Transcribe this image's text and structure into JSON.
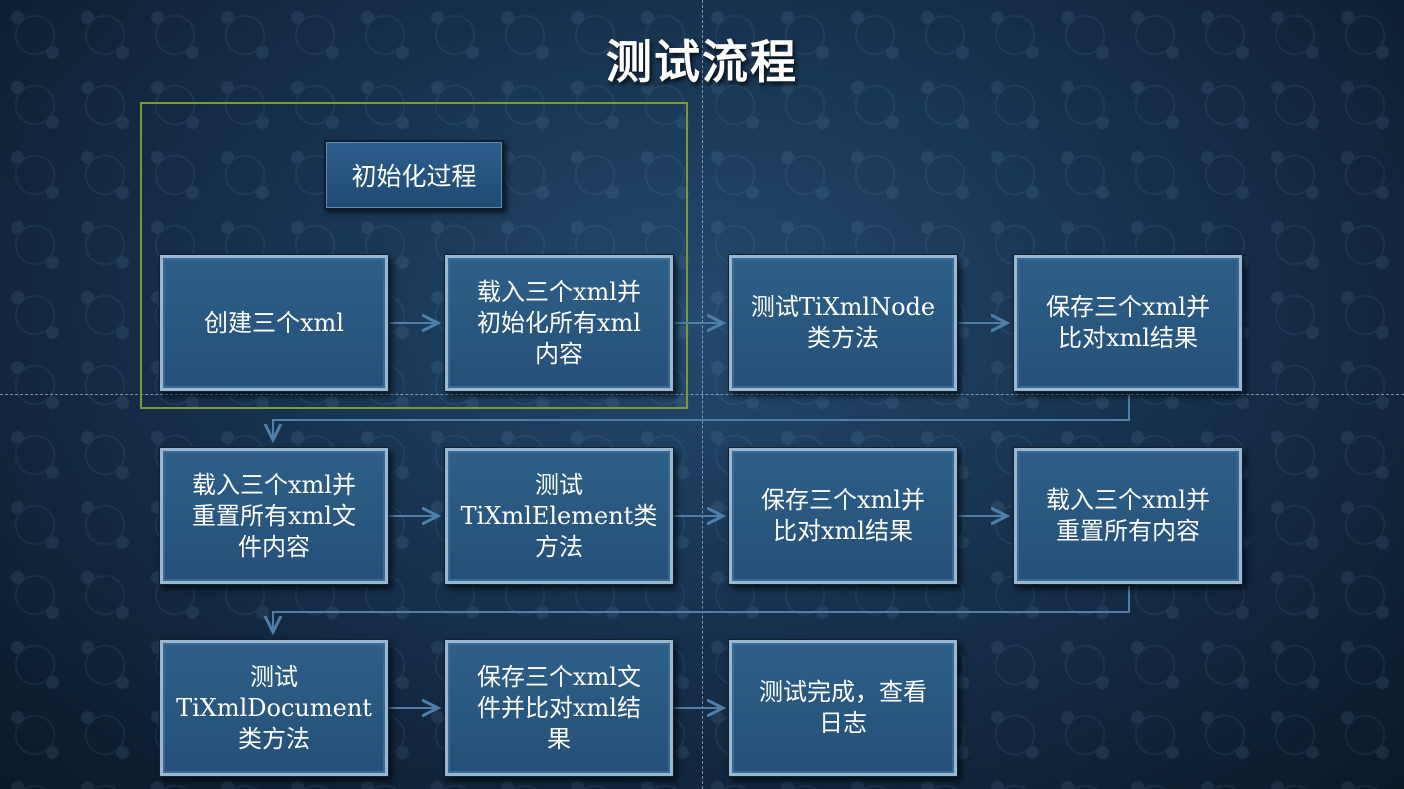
{
  "title": "测试流程",
  "group": {
    "label": "初始化过程"
  },
  "nodes": [
    {
      "text": "创建三个xml"
    },
    {
      "text": "载入三个xml并\n初始化所有xml\n内容"
    },
    {
      "text": "测试TiXmlNode\n类方法"
    },
    {
      "text": "保存三个xml并\n比对xml结果"
    },
    {
      "text": "载入三个xml并\n重置所有xml文\n件内容"
    },
    {
      "text": "测试\nTiXmlElement类\n方法"
    },
    {
      "text": "保存三个xml并\n比对xml结果"
    },
    {
      "text": "载入三个xml并\n重置所有内容"
    },
    {
      "text": "测试\nTiXmlDocument\n类方法"
    },
    {
      "text": "保存三个xml文\n件并比对xml结\n果"
    },
    {
      "text": "测试完成，查看\n日志"
    }
  ],
  "colors": {
    "node_fill": "#2a5a86",
    "node_border": "#9bb6cf",
    "connector": "#4f7fa8",
    "group_frame": "#7a9a3a"
  }
}
